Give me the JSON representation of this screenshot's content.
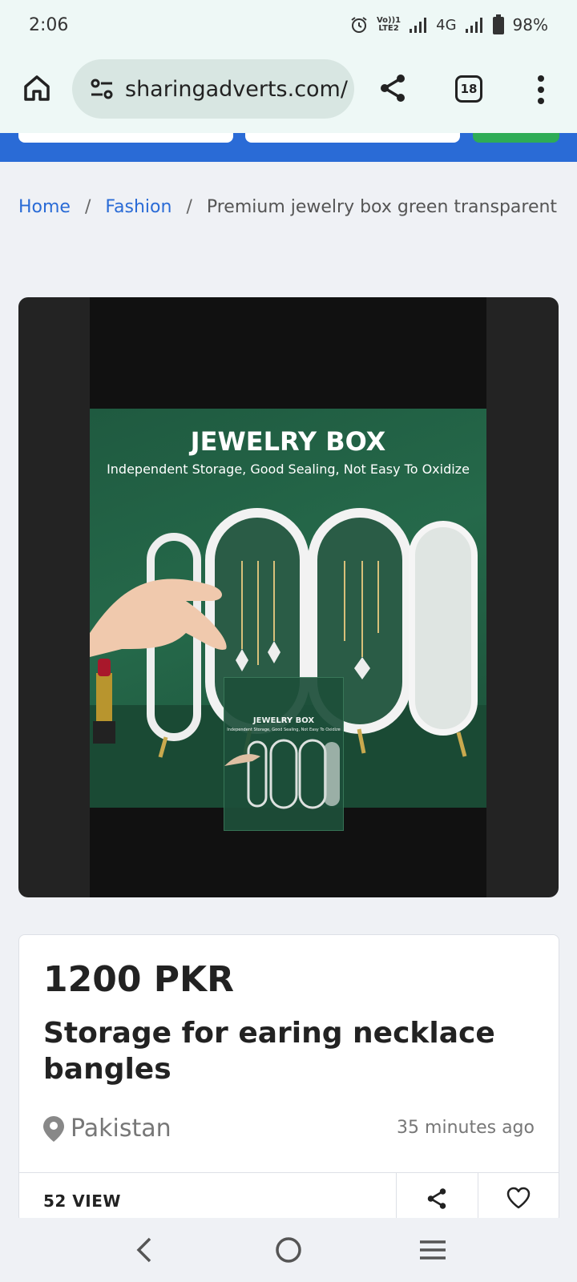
{
  "status_bar": {
    "time": "2:06",
    "battery": "98%",
    "network": "4G",
    "volte": "VoLTE2"
  },
  "browser": {
    "url": "sharingadverts.com/",
    "tab_count": "18"
  },
  "breadcrumb": {
    "home": "Home",
    "category": "Fashion",
    "current": "Premium jewelry box green transparent"
  },
  "listing_image": {
    "title": "JEWELRY BOX",
    "subtitle": "Independent Storage, Good Sealing, Not Easy To Oxidize"
  },
  "listing": {
    "price": "1200 PKR",
    "title": "Storage for earing necklace bangles",
    "location": "Pakistan",
    "posted": "35 minutes ago",
    "views": "52 VIEW"
  },
  "colors": {
    "link": "#2a6bd6",
    "header": "#2a6bd6",
    "accent_green": "#2eac56"
  }
}
